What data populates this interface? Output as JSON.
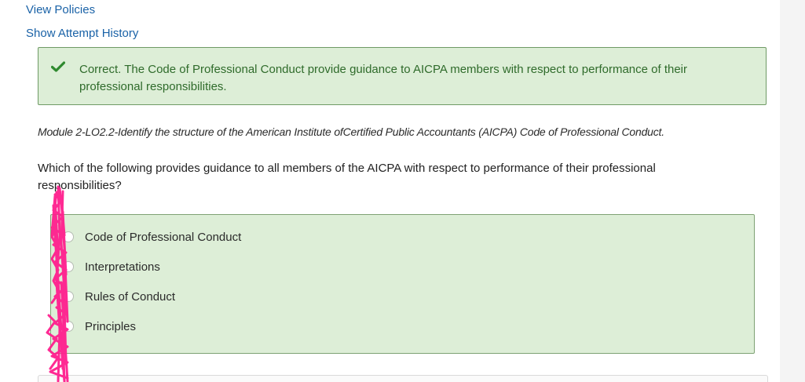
{
  "links": {
    "view_policies": "View Policies",
    "show_attempt_history": "Show Attempt History"
  },
  "feedback": {
    "status": "correct",
    "message": "Correct. The Code of Professional Conduct provide guidance to AICPA members with respect to performance of their professional responsibilities.",
    "icon": "checkmark-icon",
    "accent_color": "#2f6b2b",
    "background_color": "#ddeed7"
  },
  "question": {
    "objective": "Module 2-LO2.2-Identify the structure of the American Institute ofCertified Public Accountants (AICPA) Code of Professional Conduct.",
    "prompt": "Which of the following provides guidance to all members of the AICPA with respect to performance of their professional responsibilities?",
    "options": [
      {
        "label": "Code of Professional Conduct"
      },
      {
        "label": "Interpretations"
      },
      {
        "label": "Rules of Conduct"
      },
      {
        "label": "Principles"
      }
    ]
  },
  "annotation": {
    "type": "freehand-scribble",
    "color": "#ff1f8e"
  }
}
